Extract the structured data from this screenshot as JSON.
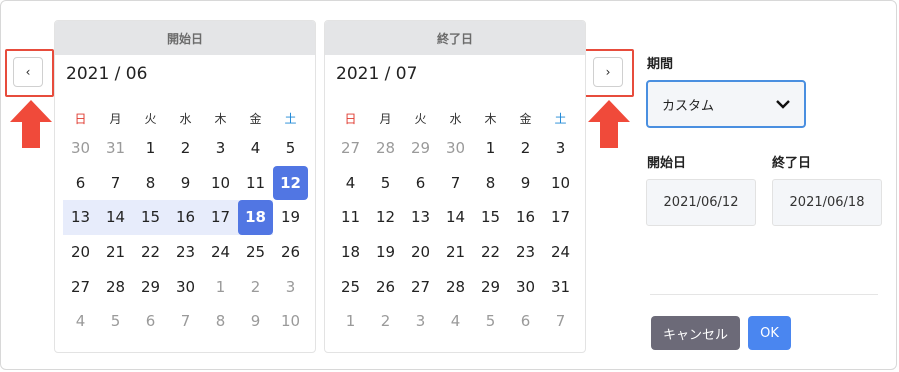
{
  "left_calendar": {
    "header": "開始日",
    "month": "2021 / 06",
    "weekdays": [
      "日",
      "月",
      "火",
      "水",
      "木",
      "金",
      "土"
    ],
    "weeks": [
      [
        "30",
        "31",
        "1",
        "2",
        "3",
        "4",
        "5"
      ],
      [
        "6",
        "7",
        "8",
        "9",
        "10",
        "11",
        "12"
      ],
      [
        "13",
        "14",
        "15",
        "16",
        "17",
        "18",
        "19"
      ],
      [
        "20",
        "21",
        "22",
        "23",
        "24",
        "25",
        "26"
      ],
      [
        "27",
        "28",
        "29",
        "30",
        "1",
        "2",
        "3"
      ],
      [
        "4",
        "5",
        "6",
        "7",
        "8",
        "9",
        "10"
      ]
    ]
  },
  "right_calendar": {
    "header": "終了日",
    "month": "2021 / 07",
    "weekdays": [
      "日",
      "月",
      "火",
      "水",
      "木",
      "金",
      "土"
    ],
    "weeks": [
      [
        "27",
        "28",
        "29",
        "30",
        "1",
        "2",
        "3"
      ],
      [
        "4",
        "5",
        "6",
        "7",
        "8",
        "9",
        "10"
      ],
      [
        "11",
        "12",
        "13",
        "14",
        "15",
        "16",
        "17"
      ],
      [
        "18",
        "19",
        "20",
        "21",
        "22",
        "23",
        "24"
      ],
      [
        "25",
        "26",
        "27",
        "28",
        "29",
        "30",
        "31"
      ],
      [
        "1",
        "2",
        "3",
        "4",
        "5",
        "6",
        "7"
      ]
    ]
  },
  "nav": {
    "prev_icon": "‹",
    "next_icon": "›"
  },
  "side": {
    "period_label": "期間",
    "period_value": "カスタム",
    "start_label": "開始日",
    "end_label": "終了日",
    "start_value": "2021/06/12",
    "end_value": "2021/06/18",
    "cancel_label": "キャンセル",
    "ok_label": "OK"
  },
  "colors": {
    "accent": "#5176e3",
    "range": "#e7ecfb",
    "highlight": "#e74c3c",
    "sunday": "#e03a2f",
    "saturday": "#1e88d6"
  }
}
